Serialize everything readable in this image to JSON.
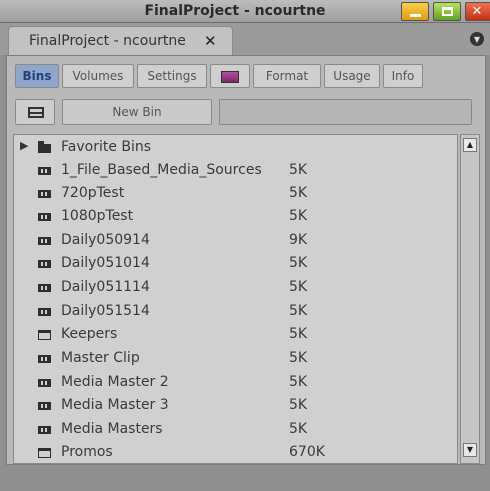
{
  "window": {
    "title": "FinalProject - ncourtne",
    "close_glyph": "✕"
  },
  "tab": {
    "label": "FinalProject - ncourtne",
    "close_glyph": "✕"
  },
  "toolbar": {
    "tabs": [
      "Bins",
      "Volumes",
      "Settings",
      "",
      "Format",
      "Usage",
      "Info"
    ],
    "active": "Bins"
  },
  "new_bin_label": "New Bin",
  "tree": {
    "favorite_bins": "Favorite Bins",
    "items": [
      {
        "name": "1_File_Based_Media_Sources",
        "size": "5K",
        "icon": "bin-closed-icon"
      },
      {
        "name": "720pTest",
        "size": "5K",
        "icon": "bin-closed-icon"
      },
      {
        "name": "1080pTest",
        "size": "5K",
        "icon": "bin-closed-icon"
      },
      {
        "name": "Daily050914",
        "size": "9K",
        "icon": "bin-closed-icon"
      },
      {
        "name": "Daily051014",
        "size": "5K",
        "icon": "bin-closed-icon"
      },
      {
        "name": "Daily051114",
        "size": "5K",
        "icon": "bin-closed-icon"
      },
      {
        "name": "Daily051514",
        "size": "5K",
        "icon": "bin-closed-icon"
      },
      {
        "name": "Keepers",
        "size": "5K",
        "icon": "bin-open-icon"
      },
      {
        "name": "Master Clip",
        "size": "5K",
        "icon": "bin-closed-icon"
      },
      {
        "name": "Media Master 2",
        "size": "5K",
        "icon": "bin-closed-icon"
      },
      {
        "name": "Media Master 3",
        "size": "5K",
        "icon": "bin-closed-icon"
      },
      {
        "name": "Media Masters",
        "size": "5K",
        "icon": "bin-closed-icon"
      },
      {
        "name": "Promos",
        "size": "670K",
        "icon": "bin-open-icon"
      }
    ]
  }
}
